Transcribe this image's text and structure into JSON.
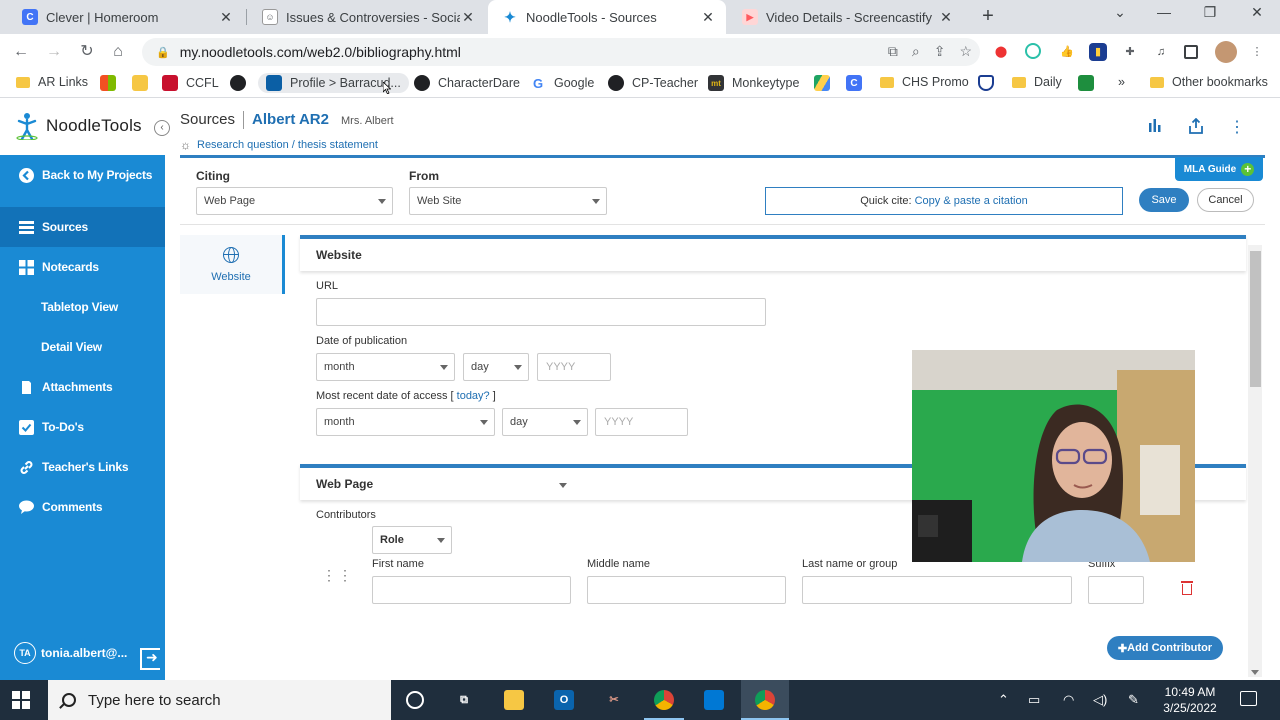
{
  "browser": {
    "tabs": [
      {
        "title": "Clever | Homeroom",
        "favicon": "C",
        "favicon_color": "#4274f6",
        "active": false
      },
      {
        "title": "Issues & Controversies - Social M",
        "favicon": "👤",
        "favicon_color": "#5f6368",
        "active": false
      },
      {
        "title": "NoodleTools - Sources",
        "favicon": "N",
        "favicon_color": "#1a8ad4",
        "active": true
      },
      {
        "title": "Video Details - Screencastify",
        "favicon": "▶",
        "favicon_color": "#ff5a5f",
        "active": false
      }
    ],
    "url": "my.noodletools.com/web2.0/bibliography.html",
    "bookmarks": [
      {
        "label": "AR Links",
        "icon": "folder-icon"
      },
      {
        "label": "",
        "icon": "microsoft-icon"
      },
      {
        "label": "",
        "icon": "keep-icon"
      },
      {
        "label": "CCFL",
        "icon": "ccfl-icon"
      },
      {
        "label": "",
        "icon": "globe-icon"
      },
      {
        "label": "Profile > Barracud...",
        "icon": "barracuda-icon"
      },
      {
        "label": "CharacterDare",
        "icon": "globe-icon"
      },
      {
        "label": "Google",
        "icon": "google-icon"
      },
      {
        "label": "CP-Teacher",
        "icon": "globe-icon"
      },
      {
        "label": "Monkeytype",
        "icon": "monkeytype-icon"
      },
      {
        "label": "",
        "icon": "drive-icon"
      },
      {
        "label": "",
        "icon": "clever-icon"
      },
      {
        "label": "CHS Promo",
        "icon": "folder-icon"
      },
      {
        "label": "",
        "icon": "shield-icon"
      },
      {
        "label": "Daily",
        "icon": "folder-icon"
      },
      {
        "label": "",
        "icon": "classroom-icon"
      },
      {
        "label": "»",
        "icon": ""
      },
      {
        "label": "Other bookmarks",
        "icon": "folder-icon"
      }
    ]
  },
  "app": {
    "logo": "NoodleTools",
    "breadcrumb": {
      "section": "Sources",
      "project": "Albert AR2",
      "teacher": "Mrs. Albert"
    },
    "research_link": "Research question / thesis statement"
  },
  "sidebar": {
    "items": [
      {
        "label": "Back to My Projects",
        "icon": "arrow-left-circle-icon"
      },
      {
        "label": "Sources",
        "icon": "list-icon",
        "active": true
      },
      {
        "label": "Notecards",
        "icon": "grid-icon"
      },
      {
        "label": "Tabletop View",
        "sub": true
      },
      {
        "label": "Detail View",
        "sub": true
      },
      {
        "label": "Attachments",
        "icon": "paperclip-icon"
      },
      {
        "label": "To-Do's",
        "icon": "checkbox-icon"
      },
      {
        "label": "Teacher's Links",
        "icon": "link-icon"
      },
      {
        "label": "Comments",
        "icon": "comment-icon"
      }
    ],
    "user": {
      "initials": "TA",
      "name": "tonia.albert@..."
    }
  },
  "form": {
    "mla_guide": "MLA Guide",
    "citing_label": "Citing",
    "citing_value": "Web Page",
    "from_label": "From",
    "from_value": "Web Site",
    "quick_cite_prefix": "Quick cite:",
    "quick_cite_link": "Copy & paste a citation",
    "save": "Save",
    "cancel": "Cancel",
    "side_tab": "Website",
    "website_section": "Website",
    "url_label": "URL",
    "pub_date_label": "Date of publication",
    "month": "month",
    "day": "day",
    "year_placeholder": "YYYY",
    "access_label": "Most recent date of access [",
    "access_today": "today?",
    "access_close": "]",
    "webpage_section": "Web Page",
    "contributors_label": "Contributors",
    "role": "Role",
    "first_name": "First name",
    "middle_name": "Middle name",
    "last_name": "Last name or group",
    "suffix": "Suffix",
    "add_contributor": "Add Contributor"
  },
  "taskbar": {
    "search_placeholder": "Type here to search",
    "time": "10:49 AM",
    "date": "3/25/2022"
  }
}
